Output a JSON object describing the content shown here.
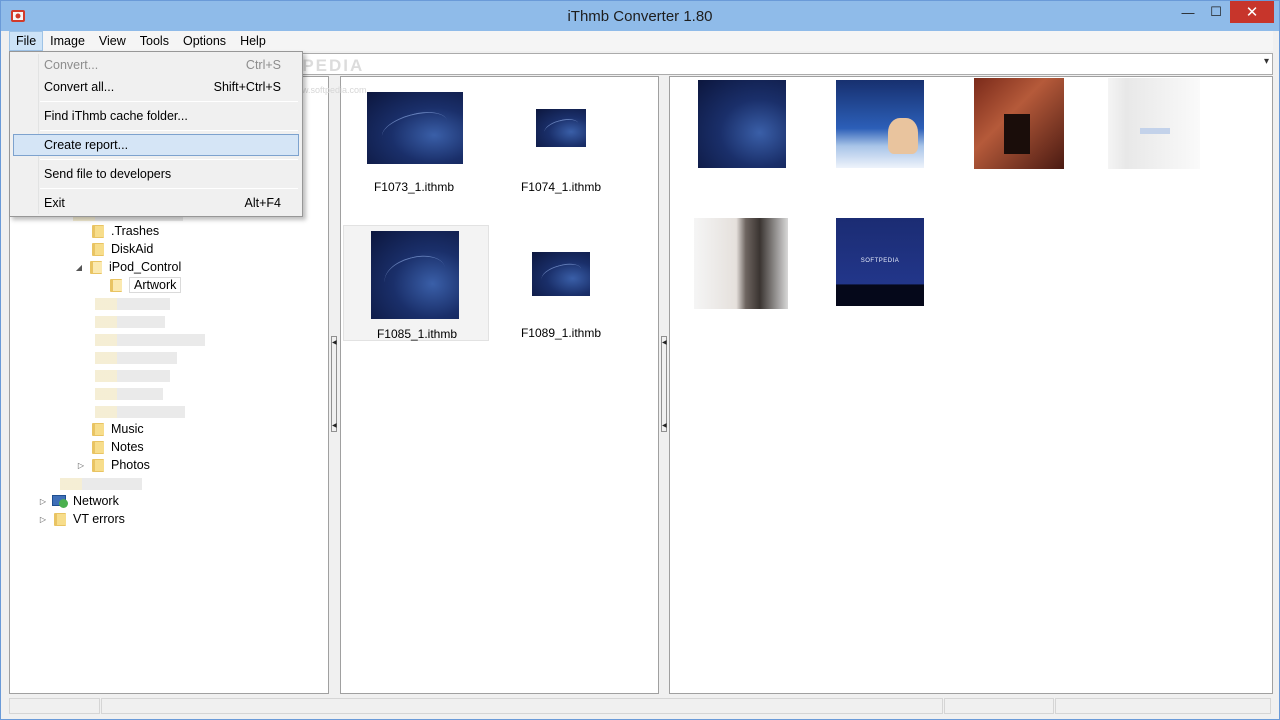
{
  "window": {
    "title": "iThmb Converter 1.80",
    "min_symbol": "—",
    "max_symbol": "☐",
    "close_symbol": "✕"
  },
  "menubar": {
    "items": [
      "File",
      "Image",
      "View",
      "Tools",
      "Options",
      "Help"
    ]
  },
  "address": {
    "value": "",
    "arrow": "▾",
    "watermark": "SOFTPEDIA",
    "watermark_sub": "www.softpedia.com"
  },
  "file_menu": {
    "convert": {
      "label": "Convert...",
      "shortcut": "Ctrl+S"
    },
    "convert_all": {
      "label": "Convert all...",
      "shortcut": "Shift+Ctrl+S"
    },
    "find_cache": {
      "label": "Find iThmb cache folder..."
    },
    "create_report": {
      "label": "Create report..."
    },
    "send_file": {
      "label": "Send file to developers"
    },
    "exit": {
      "label": "Exit",
      "shortcut": "Alt+F4"
    }
  },
  "tree": {
    "trashes": ".Trashes",
    "diskaid": "DiskAid",
    "ipod_control": "iPod_Control",
    "artwork": "Artwork",
    "music": "Music",
    "notes": "Notes",
    "photos": "Photos",
    "network": "Network",
    "vt_errors": "VT errors",
    "expanded_arrow": "◢",
    "collapsed_arrow": "▷"
  },
  "thumbnails": [
    {
      "name": "F1073_1.ithmb",
      "selected": false
    },
    {
      "name": "F1074_1.ithmb",
      "selected": false
    },
    {
      "name": "F1085_1.ithmb",
      "selected": true
    },
    {
      "name": "F1089_1.ithmb",
      "selected": false
    }
  ],
  "preview": {
    "softpedia_label": "SOFTPEDIA"
  },
  "colors": {
    "titlebar": "#8fbbe9",
    "close_button": "#c7352b",
    "menu_highlight": "#d5e5f6",
    "folder": "#e9c463"
  }
}
